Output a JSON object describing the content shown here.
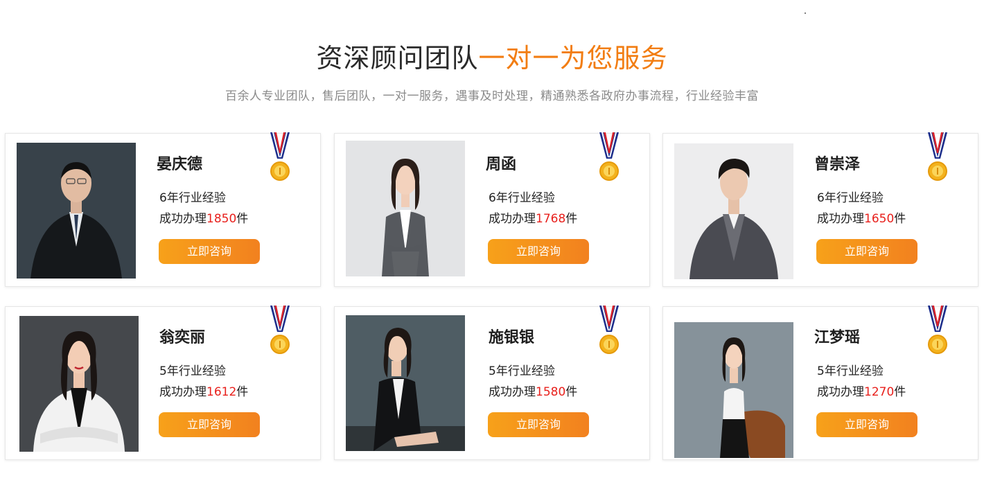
{
  "header": {
    "title_main": "资深顾问团队",
    "title_highlight": "一对一为您服务",
    "subtitle": "百余人专业团队，售后团队，一对一服务，遇事及时处理，精通熟悉各政府办事流程，行业经验丰富"
  },
  "colors": {
    "accent": "#f27d12",
    "count": "#e8201c",
    "button_from": "#f7a11a",
    "button_to": "#f2811f"
  },
  "advisors": [
    {
      "name": "晏庆德",
      "experience": "6年行业经验",
      "success_prefix": "成功办理",
      "success_count": "1850",
      "success_suffix": "件",
      "button": "立即咨询"
    },
    {
      "name": "周函",
      "experience": "6年行业经验",
      "success_prefix": "成功办理",
      "success_count": "1768",
      "success_suffix": "件",
      "button": "立即咨询"
    },
    {
      "name": "曾崇泽",
      "experience": "6年行业经验",
      "success_prefix": "成功办理",
      "success_count": "1650",
      "success_suffix": "件",
      "button": "立即咨询"
    },
    {
      "name": "翁奕丽",
      "experience": "5年行业经验",
      "success_prefix": "成功办理",
      "success_count": "1612",
      "success_suffix": "件",
      "button": "立即咨询"
    },
    {
      "name": "施银银",
      "experience": "5年行业经验",
      "success_prefix": "成功办理",
      "success_count": "1580",
      "success_suffix": "件",
      "button": "立即咨询"
    },
    {
      "name": "江梦瑶",
      "experience": "5年行业经验",
      "success_prefix": "成功办理",
      "success_count": "1270",
      "success_suffix": "件",
      "button": "立即咨询"
    }
  ]
}
